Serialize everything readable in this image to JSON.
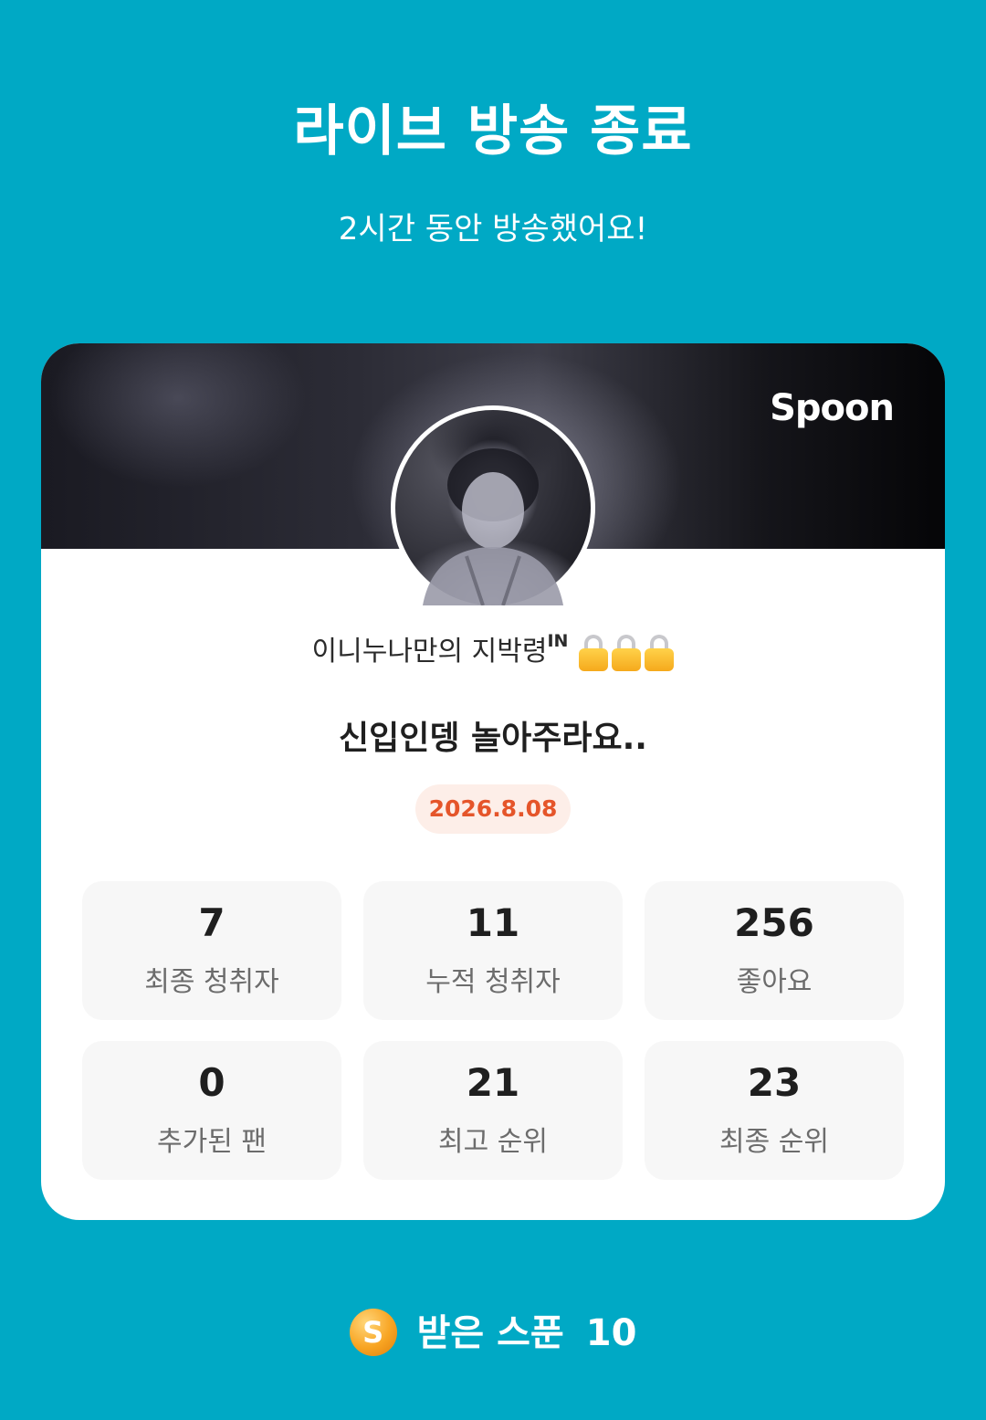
{
  "header": {
    "title": "라이브 방송 종료",
    "subtitle": "2시간 동안 방송했어요!"
  },
  "card": {
    "brand": "Spoon",
    "avatar_icon": "profile-avatar",
    "username": "이니누나만의 지박령",
    "username_superscript": "IN",
    "username_icons": [
      "lock-icon",
      "lock-icon",
      "lock-icon"
    ],
    "broadcast_title": "신입인뎅 놀아주라요..",
    "date": "2026.8.08",
    "stats": [
      {
        "value": "7",
        "label": "최종 청취자"
      },
      {
        "value": "11",
        "label": "누적 청취자"
      },
      {
        "value": "256",
        "label": "좋아요"
      },
      {
        "value": "0",
        "label": "추가된 팬"
      },
      {
        "value": "21",
        "label": "최고 순위"
      },
      {
        "value": "23",
        "label": "최종 순위"
      }
    ]
  },
  "footer": {
    "coin_glyph": "S",
    "received_label": "받은 스푼",
    "received_count": "10"
  },
  "colors": {
    "background": "#00a9c5",
    "card": "#ffffff",
    "stat_box": "#f7f7f7",
    "date_text": "#e5552a",
    "date_bg": "#fdeee8"
  }
}
